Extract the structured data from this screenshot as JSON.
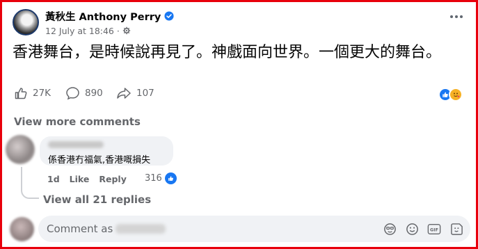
{
  "post": {
    "author": "黃秋生 Anthony Perry",
    "date": "12 July at 18:46",
    "text": "香港舞台，是時候說再見了。神戲面向世界。一個更大的舞台。",
    "like_count": "27K",
    "comment_count": "890",
    "share_count": "107"
  },
  "view_more_comments": "View more comments",
  "comment": {
    "author_name": "",
    "text": "係香港冇福氣,香港嘅損失",
    "age": "1d",
    "like_action": "Like",
    "reply_action": "Reply",
    "like_count": "316"
  },
  "view_replies": "View all 21 replies",
  "composer": {
    "placeholder": "Comment as"
  },
  "colors": {
    "accent": "#1877f2",
    "frame": "#e8000b",
    "muted_text": "#65676b",
    "bubble": "#f0f2f5"
  },
  "icons": [
    "verified-badge-icon",
    "globe-settings-icon",
    "more-options-icon",
    "like-thumb-icon",
    "comment-bubble-icon",
    "share-arrow-icon",
    "like-reaction-icon",
    "care-reaction-icon",
    "sticker-icon",
    "emoji-icon",
    "gif-icon",
    "sticker-alt-icon"
  ]
}
